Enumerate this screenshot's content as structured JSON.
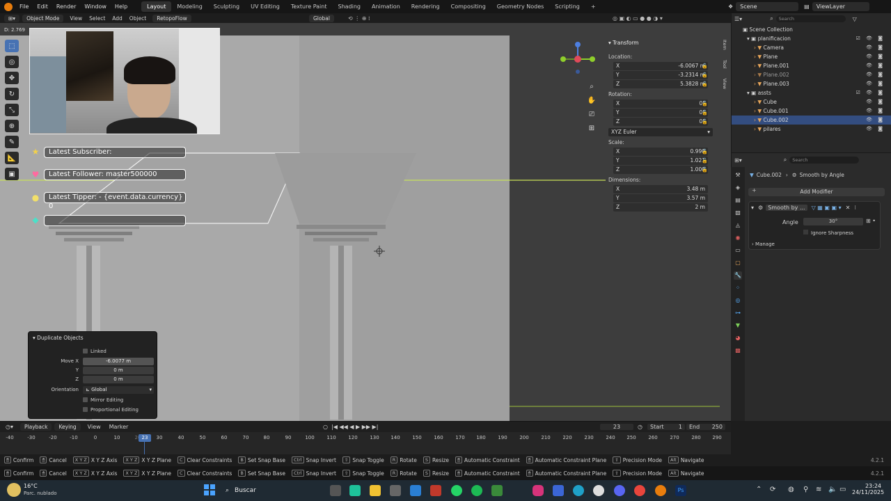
{
  "menu": {
    "items": [
      "File",
      "Edit",
      "Render",
      "Window",
      "Help"
    ],
    "workspaces": [
      "Layout",
      "Modeling",
      "Sculpting",
      "UV Editing",
      "Texture Paint",
      "Shading",
      "Animation",
      "Rendering",
      "Compositing",
      "Geometry Nodes",
      "Scripting"
    ],
    "active_workspace": "Layout",
    "add_tab": "+",
    "scene": "Scene",
    "view_layer": "ViewLayer"
  },
  "viewport_header": {
    "mode": "Object Mode",
    "menus": [
      "View",
      "Select",
      "Add",
      "Object"
    ],
    "addon": "RetopoFlow",
    "transform_orientation": "Global"
  },
  "viewport": {
    "distance_readout": "D: 2.769"
  },
  "stream_overlay": {
    "latest_subscriber": "Latest Subscriber:",
    "latest_follower": "Latest Follower: master500000",
    "latest_tipper": "Latest Tipper:  - {event.data.currency} 0",
    "empty_slot": ""
  },
  "transform_panel": {
    "title": "Transform",
    "location_label": "Location:",
    "location": {
      "x": "-6.0067 m",
      "y": "-3.2314 m",
      "z": "5.3828 m"
    },
    "rotation_label": "Rotation:",
    "rotation": {
      "x": "0°",
      "y": "0°",
      "z": "0°"
    },
    "rotation_mode": "XYZ Euler",
    "scale_label": "Scale:",
    "scale": {
      "x": "0.990",
      "y": "1.021",
      "z": "1.000"
    },
    "dimensions_label": "Dimensions:",
    "dimensions": {
      "x": "3.48 m",
      "y": "3.57 m",
      "z": "2 m"
    },
    "axis_labels": {
      "x": "X",
      "y": "Y",
      "z": "Z"
    },
    "side_tabs": [
      "Item",
      "Tool",
      "View"
    ]
  },
  "outliner": {
    "search_placeholder": "Search",
    "rows": [
      {
        "label": "Scene Collection",
        "indent": 0
      },
      {
        "label": "planificacion",
        "indent": 1
      },
      {
        "label": "Camera",
        "indent": 2
      },
      {
        "label": "Plane",
        "indent": 2
      },
      {
        "label": "Plane.001",
        "indent": 2
      },
      {
        "label": "Plane.002",
        "indent": 2
      },
      {
        "label": "Plane.003",
        "indent": 2
      },
      {
        "label": "assts",
        "indent": 1
      },
      {
        "label": "Cube",
        "indent": 2
      },
      {
        "label": "Cube.001",
        "indent": 2
      },
      {
        "label": "Cube.002",
        "indent": 2
      },
      {
        "label": "pilares",
        "indent": 2
      }
    ],
    "selected": "Cube.002"
  },
  "properties": {
    "search_placeholder": "Search",
    "object_name": "Cube.002",
    "modifier_name": "Smooth by Angle",
    "add_modifier": "Add Modifier",
    "modifier_short": "Smooth by ...",
    "angle_label": "Angle",
    "angle_value": "30°",
    "ignore_sharpness": "Ignore Sharpness",
    "manage": "Manage"
  },
  "duplicate_panel": {
    "title": "Duplicate Objects",
    "linked": "Linked",
    "move_x_label": "Move X",
    "move_x": "-6.0077 m",
    "y_label": "Y",
    "y": "0 m",
    "z_label": "Z",
    "z": "0 m",
    "orientation_label": "Orientation",
    "orientation": "Global",
    "mirror_editing": "Mirror Editing",
    "proportional_editing": "Proportional Editing"
  },
  "timeline": {
    "menus": [
      "Playback",
      "Keying",
      "View",
      "Marker"
    ],
    "current_frame": "23",
    "start_label": "Start",
    "start": "1",
    "end_label": "End",
    "end": "250",
    "ticks": [
      "-40",
      "-30",
      "-20",
      "-10",
      "0",
      "10",
      "20",
      "30",
      "40",
      "50",
      "60",
      "70",
      "80",
      "90",
      "100",
      "110",
      "120",
      "130",
      "140",
      "150",
      "160",
      "170",
      "180",
      "190",
      "200",
      "210",
      "220",
      "230",
      "240",
      "250",
      "260",
      "270",
      "280",
      "290"
    ],
    "playhead": "23"
  },
  "statusbar": {
    "items": [
      "Confirm",
      "Cancel",
      "X Y Z Axis",
      "X Y Z Plane",
      "Clear Constraints",
      "Set Snap Base",
      "Snap Invert",
      "Snap Toggle",
      "Rotate",
      "Resize",
      "Automatic Constraint",
      "Automatic Constraint Plane",
      "Precision Mode",
      "Navigate"
    ],
    "keys": [
      "",
      "",
      "X Y Z",
      "X Y Z",
      "C",
      "B",
      "Ctrl",
      "",
      "R",
      "S",
      "",
      "",
      "",
      "Alt"
    ],
    "version": "4.2.1"
  },
  "taskbar": {
    "weather_temp": "16°C",
    "weather_desc": "Parc. nublado",
    "search": "Buscar",
    "time": "23:24",
    "date": "24/11/2025"
  }
}
